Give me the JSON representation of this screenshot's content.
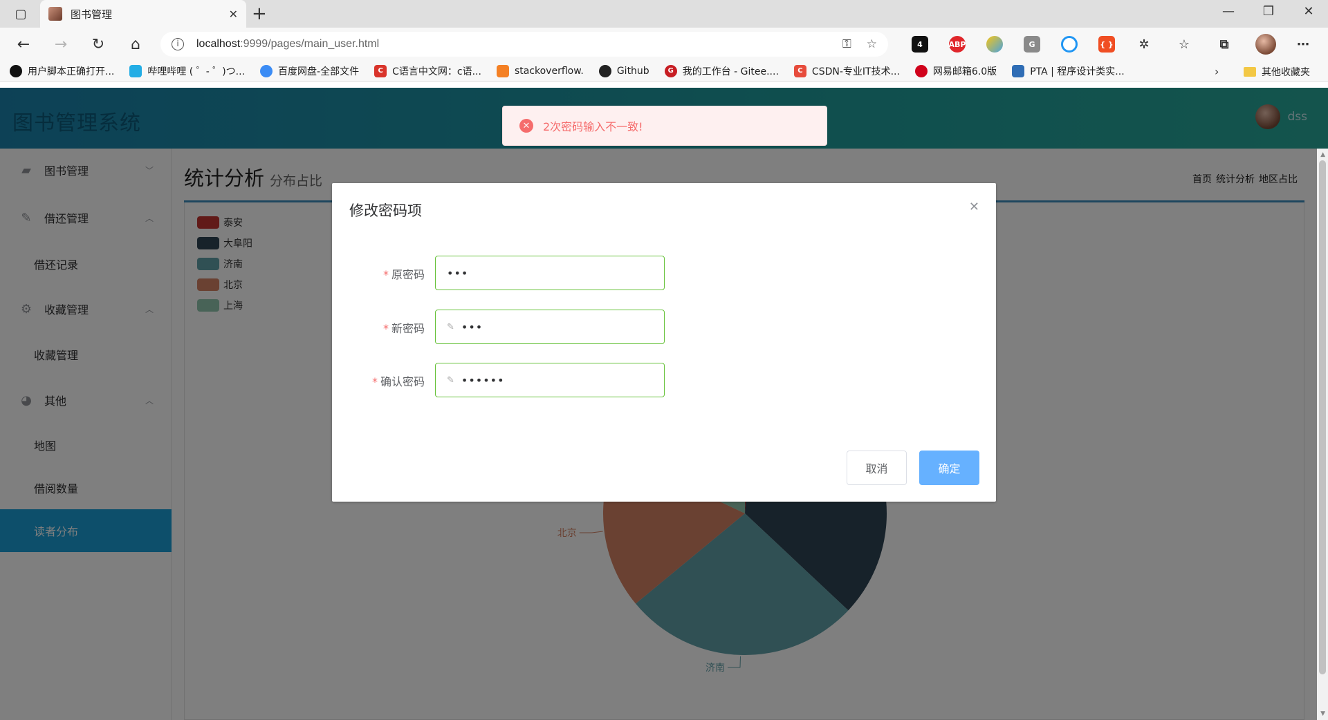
{
  "browser": {
    "tab_title": "图书管理",
    "url_host": "localhost",
    "url_rest": ":9999/pages/main_user.html",
    "extension_badge": "4",
    "bookmarks": [
      {
        "label": "用户脚本正确打开...",
        "color": "#111111"
      },
      {
        "label": "哔哩哔哩 ( ゜- ゜)つ...",
        "color": "#23ade5"
      },
      {
        "label": "百度网盘-全部文件",
        "color": "#3b8cf5"
      },
      {
        "label": "C语言中文网：c语...",
        "color": "#d9342b"
      },
      {
        "label": "stackoverflow.",
        "color": "#f48024"
      },
      {
        "label": "Github",
        "color": "#222222"
      },
      {
        "label": "我的工作台 - Gitee....",
        "color": "#c71d23"
      },
      {
        "label": "CSDN-专业IT技术...",
        "color": "#e74c3c"
      },
      {
        "label": "网易邮箱6.0版",
        "color": "#d0021b"
      },
      {
        "label": "PTA | 程序设计类实...",
        "color": "#2f6db5"
      }
    ],
    "bookmark_folder": "其他收藏夹"
  },
  "app": {
    "title": "图书管理系统",
    "user_name": "dss"
  },
  "sidebar": {
    "items": [
      {
        "label": "图书管理",
        "icon": "book-icon",
        "arrow": "﹀"
      },
      {
        "label": "借还管理",
        "icon": "pencil-icon",
        "arrow": "︿"
      },
      {
        "label": "借还记录"
      },
      {
        "label": "收藏管理",
        "icon": "gear-icon",
        "arrow": "︿"
      },
      {
        "label": "收藏管理"
      },
      {
        "label": "其他",
        "icon": "palette-icon",
        "arrow": "︿"
      },
      {
        "label": "地图"
      },
      {
        "label": "借阅数量"
      },
      {
        "label": "读者分布"
      }
    ]
  },
  "page": {
    "title": "统计分析",
    "subtitle": "分布占比",
    "breadcrumb": [
      "首页",
      "统计分析",
      "地区占比"
    ]
  },
  "chart_data": {
    "type": "pie",
    "categories": [
      "泰安",
      "大阜阳",
      "济南",
      "北京",
      "上海"
    ],
    "values": [
      1,
      36,
      27,
      18,
      18
    ],
    "colors": [
      "#c23531",
      "#2f4554",
      "#61a0a8",
      "#d48265",
      "#91c7ae"
    ],
    "visible_labels": [
      "大阜阳",
      "济南",
      "北京"
    ],
    "legend_position": "top-left"
  },
  "dialog": {
    "title": "修改密码项",
    "fields": [
      {
        "label": "原密码",
        "value": "•••"
      },
      {
        "label": "新密码",
        "value": "•••"
      },
      {
        "label": "确认密码",
        "value": "••••••"
      }
    ],
    "cancel": "取消",
    "confirm": "确定"
  },
  "message": {
    "text": "2次密码输入不一致!",
    "type": "error",
    "color": "#f56c6c"
  }
}
